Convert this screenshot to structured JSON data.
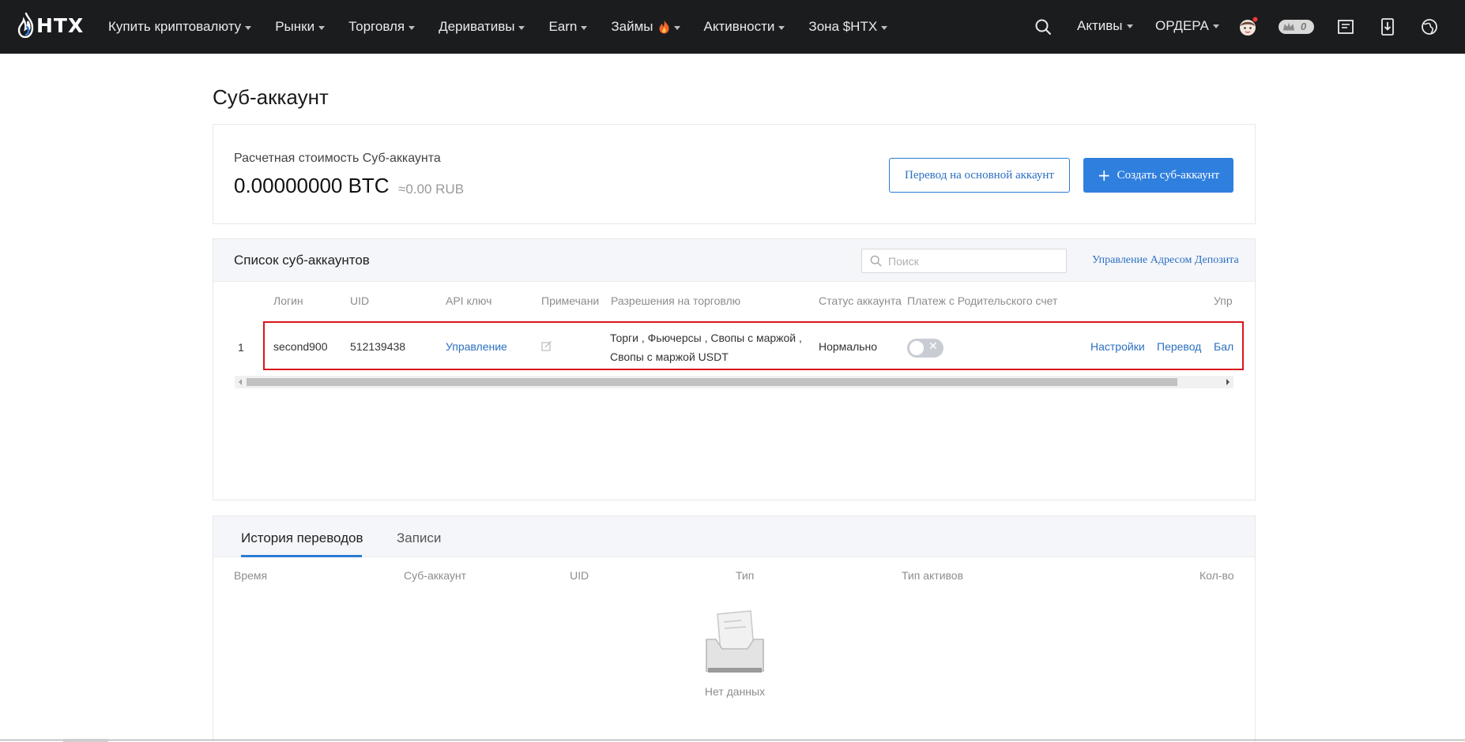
{
  "brand": {
    "name": "HTX"
  },
  "nav": {
    "items": [
      {
        "label": "Купить криптовалюту",
        "caret": true
      },
      {
        "label": "Рынки",
        "caret": true
      },
      {
        "label": "Торговля",
        "caret": true
      },
      {
        "label": "Деривативы",
        "caret": true
      },
      {
        "label": "Earn",
        "caret": true
      },
      {
        "label": "Займы",
        "caret": true,
        "badge_icon": "fire-icon"
      },
      {
        "label": "Активности",
        "caret": true
      },
      {
        "label": "Зона $HTX",
        "caret": true
      }
    ],
    "right": {
      "search_icon": "search-icon",
      "assets_label": "Активы",
      "orders_label": "ОРДЕРА",
      "avatar_icon": "avatar-icon",
      "vip_badge_text": "0",
      "icons": [
        "notes-icon",
        "download-icon",
        "globe-icon"
      ]
    }
  },
  "page": {
    "title": "Суб-аккаунт"
  },
  "summary": {
    "label": "Расчетная стоимость Суб-аккаунта",
    "value": "0.00000000 BTC",
    "approx": "≈0.00 RUB",
    "transfer_button": "Перевод на основной аккаунт",
    "create_button": "Создать суб-аккаунт"
  },
  "list": {
    "title": "Список суб-аккаунтов",
    "search_placeholder": "Поиск",
    "manage_link": "Управление Адресом Депозита",
    "columns": [
      "Логин",
      "UID",
      "API ключ",
      "Примечани",
      "Разрешения на торговлю",
      "Статус аккаунта",
      "Платеж с Родительского счет",
      "Упр"
    ],
    "rows": [
      {
        "index": "1",
        "login": "second900",
        "uid": "512139438",
        "api_key": "Управление",
        "note_icon": "edit-icon",
        "permissions": "Торги , Фьючерсы , Свопы с маржой , Свопы с маржой USDT",
        "status": "Нормально",
        "parent_payment_enabled": false,
        "actions": [
          "Настройки",
          "Перевод",
          "Бал"
        ]
      }
    ]
  },
  "history": {
    "tabs": [
      {
        "label": "История переводов",
        "active": true
      },
      {
        "label": "Записи",
        "active": false
      }
    ],
    "columns": [
      "Время",
      "Суб-аккаунт",
      "UID",
      "Тип",
      "Тип активов",
      "Кол-во"
    ],
    "empty_text": "Нет данных"
  },
  "colors": {
    "nav_bg": "#1b1c1e",
    "accent": "#2f7fde",
    "link": "#2b6fc0",
    "highlight_border": "#d8161b"
  }
}
